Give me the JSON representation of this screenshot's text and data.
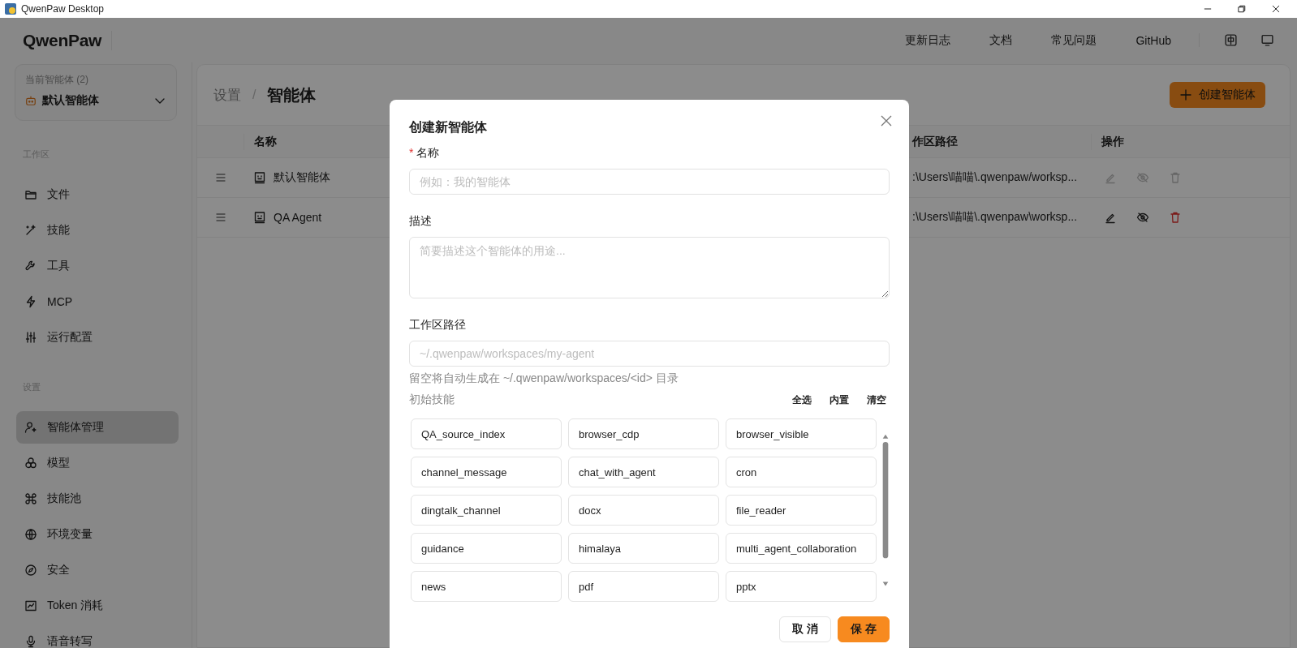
{
  "window": {
    "title": "QwenPaw Desktop"
  },
  "header": {
    "logo": "QwenPaw",
    "nav": [
      "更新日志",
      "文档",
      "常见问题",
      "GitHub"
    ]
  },
  "sidebar": {
    "agent_selector": {
      "label": "当前智能体 (2)",
      "value": "默认智能体"
    },
    "sections": [
      {
        "title": "工作区",
        "items": [
          {
            "label": "文件",
            "selected": false
          },
          {
            "label": "技能",
            "selected": false
          },
          {
            "label": "工具",
            "selected": false
          },
          {
            "label": "MCP",
            "selected": false
          },
          {
            "label": "运行配置",
            "selected": false
          }
        ]
      },
      {
        "title": "设置",
        "items": [
          {
            "label": "智能体管理",
            "selected": true
          },
          {
            "label": "模型",
            "selected": false
          },
          {
            "label": "技能池",
            "selected": false
          },
          {
            "label": "环境变量",
            "selected": false
          },
          {
            "label": "安全",
            "selected": false
          },
          {
            "label": "Token 消耗",
            "selected": false
          },
          {
            "label": "语音转写",
            "selected": false
          }
        ]
      }
    ]
  },
  "main": {
    "breadcrumb": {
      "parent": "设置",
      "separator": "/",
      "current": "智能体"
    },
    "create_button": "创建智能体",
    "table": {
      "columns": [
        "名称",
        "作区路径",
        "操作"
      ],
      "rows": [
        {
          "name": "默认智能体",
          "path": ":\\Users\\喵喵\\.qwenpaw/worksp...",
          "disabled": true
        },
        {
          "name": "QA Agent",
          "path": ":\\Users\\喵喵\\.qwenpaw\\worksp...",
          "disabled": false
        }
      ]
    }
  },
  "dialog": {
    "title": "创建新智能体",
    "required_mark": "*",
    "fields": [
      {
        "kind": "input",
        "label": "名称",
        "required": true,
        "placeholder": "例如：我的智能体"
      },
      {
        "kind": "textarea",
        "label": "描述",
        "required": false,
        "placeholder": "简要描述这个智能体的用途..."
      },
      {
        "kind": "input",
        "label": "工作区路径",
        "required": false,
        "placeholder": "~/.qwenpaw/workspaces/my-agent",
        "help": "留空将自动生成在 ~/.qwenpaw/workspaces/<id> 目录"
      }
    ],
    "skills": {
      "label": "初始技能",
      "actions": [
        "全选",
        "内置",
        "清空"
      ],
      "items": [
        "QA_source_index",
        "browser_cdp",
        "browser_visible",
        "channel_message",
        "chat_with_agent",
        "cron",
        "dingtalk_channel",
        "docx",
        "file_reader",
        "guidance",
        "himalaya",
        "multi_agent_collaboration",
        "news",
        "pdf",
        "pptx"
      ]
    },
    "buttons": [
      {
        "label": "取 消",
        "kind": "default"
      },
      {
        "label": "保 存",
        "kind": "primary"
      }
    ]
  }
}
